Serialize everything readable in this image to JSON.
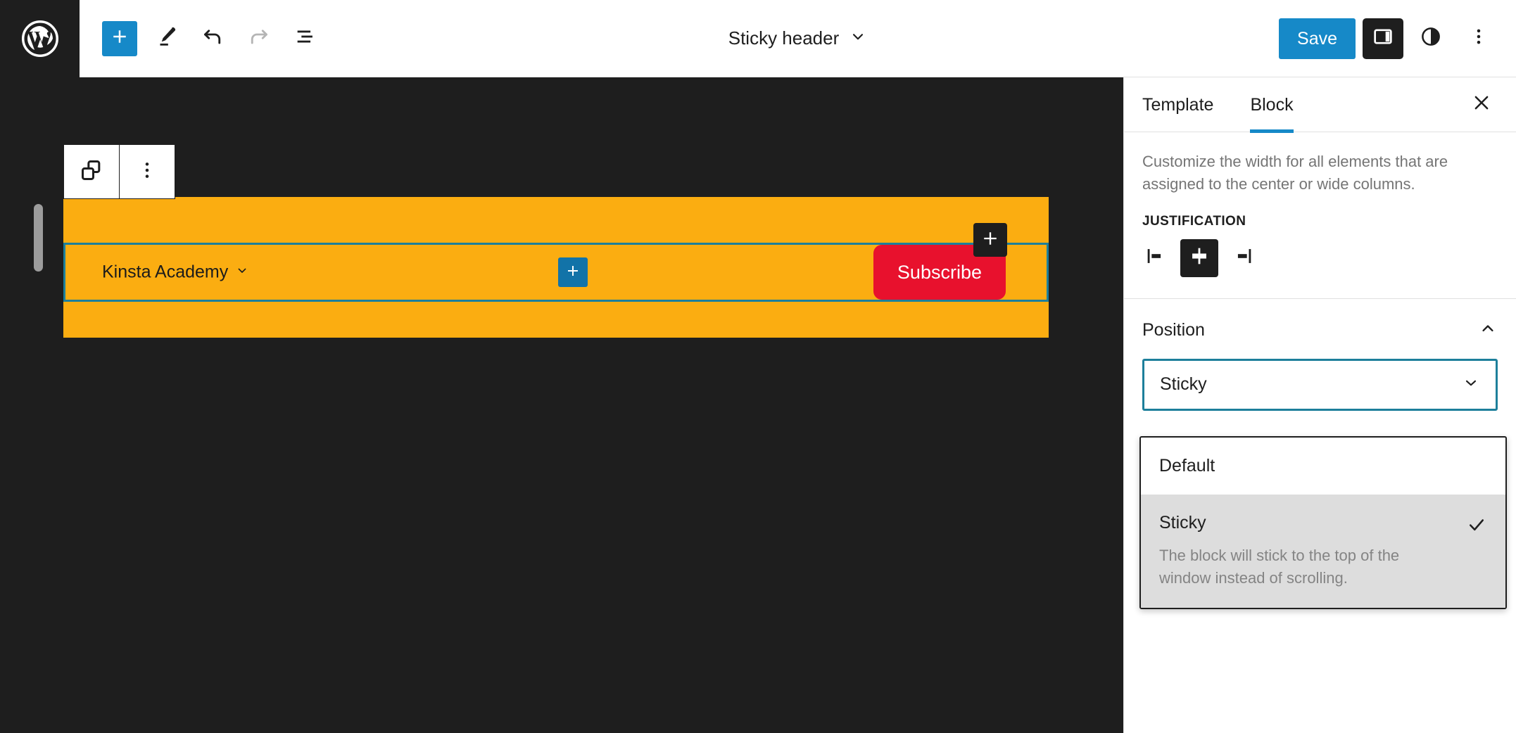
{
  "topbar": {
    "logo_icon": "wordpress-logo-icon",
    "tools": [
      {
        "name": "block-inserter-button",
        "icon": "plus-icon"
      },
      {
        "name": "edit-tool-button",
        "icon": "pencil-icon"
      },
      {
        "name": "undo-button",
        "icon": "undo-arrow-icon"
      },
      {
        "name": "redo-button",
        "icon": "redo-arrow-icon"
      },
      {
        "name": "document-overview-button",
        "icon": "list-view-icon"
      }
    ],
    "document_title": "Sticky header",
    "document_title_caret": "chevron-down-icon",
    "save_label": "Save",
    "sidebar_toggle_icon": "sidebar-panel-icon",
    "styles_icon": "contrast-circle-icon",
    "options_icon": "more-vertical-dots-icon"
  },
  "canvas": {
    "block_toolbar": [
      {
        "name": "select-parent-block-button",
        "icon": "overlapping-squares-icon"
      },
      {
        "name": "block-options-button",
        "icon": "more-vertical-dots-icon"
      }
    ],
    "header_block": {
      "background_color": "#fbad11",
      "selection_border_color": "#1d7f9b",
      "nav_label": "Kinsta Academy",
      "nav_caret_icon": "chevron-down-icon",
      "inner_inserter_icon": "plus-icon",
      "inner_inserter_color": "#1273a8",
      "subscribe_label": "Subscribe",
      "subscribe_color": "#e8112d",
      "edge_inserter_icon": "plus-icon"
    },
    "left_drag_handle": "resize-handle",
    "right_drag_handle": "resize-handle"
  },
  "sidebar": {
    "tabs": [
      {
        "label": "Template",
        "active": false
      },
      {
        "label": "Block",
        "active": true
      }
    ],
    "close_icon": "close-x-icon",
    "description": "Customize the width for all elements that are assigned to the center or wide columns.",
    "justification": {
      "label": "JUSTIFICATION",
      "options": [
        {
          "name": "justify-left-button",
          "icon": "justify-left-icon",
          "selected": false
        },
        {
          "name": "justify-center-button",
          "icon": "justify-center-icon",
          "selected": true
        },
        {
          "name": "justify-right-button",
          "icon": "justify-right-icon",
          "selected": false
        }
      ]
    },
    "position": {
      "title": "Position",
      "collapse_icon": "chevron-up-icon",
      "selected_value": "Sticky",
      "select_caret_icon": "chevron-down-icon",
      "select_border_color": "#1d7f9b",
      "dropdown": {
        "options": [
          {
            "label": "Default",
            "description": "",
            "selected": false
          },
          {
            "label": "Sticky",
            "description": "The block will stick to the top of the window instead of scrolling.",
            "selected": true,
            "check_icon": "checkmark-icon"
          }
        ]
      }
    }
  }
}
